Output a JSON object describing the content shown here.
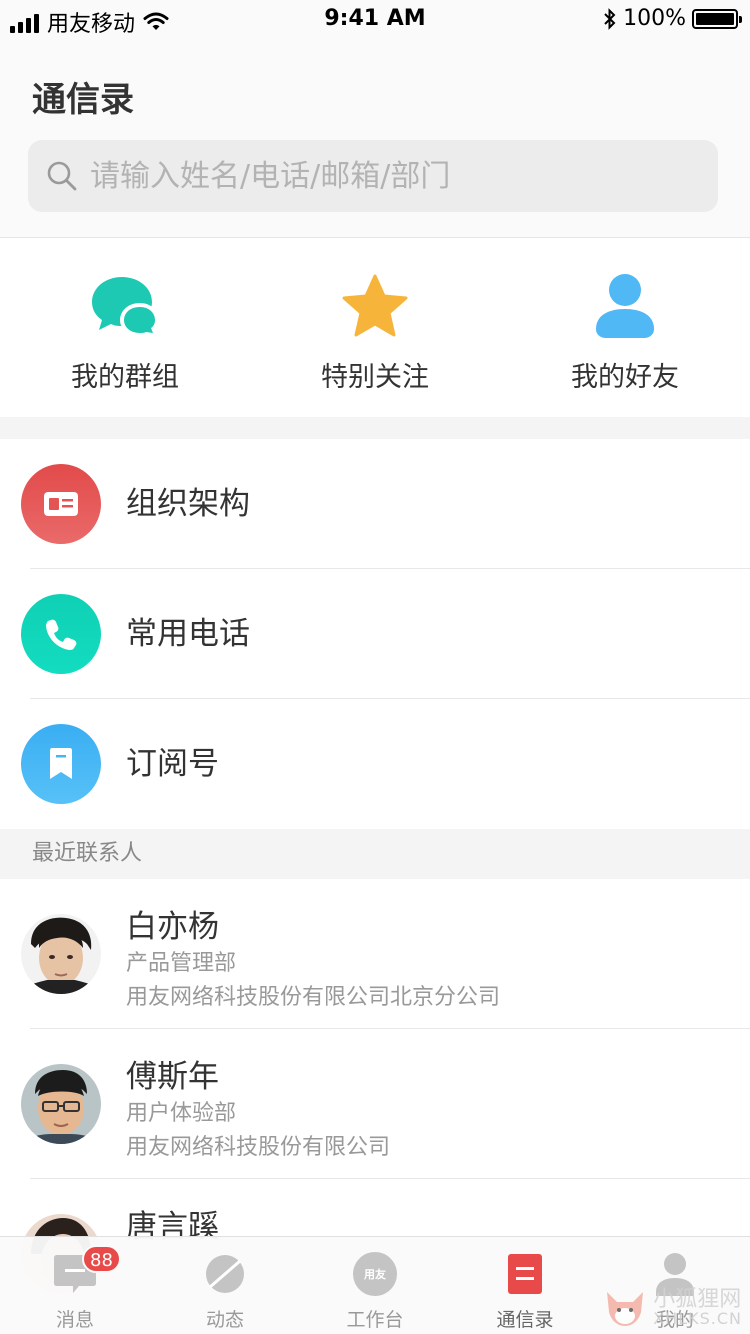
{
  "status_bar": {
    "carrier": "用友移动",
    "time": "9:41 AM",
    "battery": "100%"
  },
  "header": {
    "title": "通信录",
    "search_placeholder": "请输入姓名/电话/邮箱/部门"
  },
  "quick_actions": [
    {
      "label": "我的群组",
      "icon": "group-chat-icon",
      "color": "#1ec9b4"
    },
    {
      "label": "特别关注",
      "icon": "star-icon",
      "color": "#f7b43b"
    },
    {
      "label": "我的好友",
      "icon": "person-icon",
      "color": "#4fb8f5"
    }
  ],
  "menu": [
    {
      "label": "组织架构",
      "icon": "id-card-icon",
      "color": "#e45454"
    },
    {
      "label": "常用电话",
      "icon": "phone-icon",
      "color": "#13d3b8"
    },
    {
      "label": "订阅号",
      "icon": "bookmark-icon",
      "color": "#45b6f5"
    }
  ],
  "recent": {
    "title": "最近联系人",
    "contacts": [
      {
        "name": "白亦杨",
        "dept": "产品管理部",
        "org": "用友网络科技股份有限公司北京分公司"
      },
      {
        "name": "傅斯年",
        "dept": "用户体验部",
        "org": "用友网络科技股份有限公司"
      },
      {
        "name": "唐言蹊",
        "dept": "",
        "org": ""
      }
    ]
  },
  "tabbar": {
    "tabs": [
      {
        "label": "消息",
        "icon": "message-icon"
      },
      {
        "label": "动态",
        "icon": "planet-icon"
      },
      {
        "label": "工作台",
        "icon": "yonyou-logo-icon",
        "logo_text": "用友"
      },
      {
        "label": "通信录",
        "icon": "contacts-book-icon"
      },
      {
        "label": "我的",
        "icon": "profile-icon"
      }
    ],
    "message_badge": "88",
    "active_color": "#e84a4a"
  },
  "watermark": {
    "line1": "小狐狸网",
    "line2": "XHLKS.CN"
  }
}
